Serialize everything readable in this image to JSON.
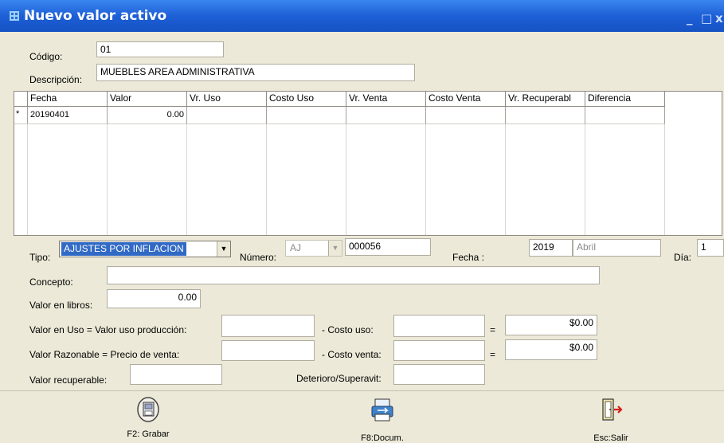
{
  "window": {
    "title": "Nuevo valor activo",
    "icon": "asset-icon",
    "controls": [
      "_",
      "□",
      "x"
    ]
  },
  "header": {
    "codigo_label": "Código:",
    "codigo_value": "01",
    "descripcion_label": "Descripción:",
    "descripcion_value": "MUEBLES AREA ADMINISTRATIVA"
  },
  "grid": {
    "columns": [
      "Fecha",
      "Valor",
      "Vr. Uso",
      "Costo Uso",
      "Vr. Venta",
      "Costo Venta",
      "Vr. Recuperabl",
      "Diferencia"
    ],
    "rows": [
      {
        "marker": "*",
        "cells": [
          "20190401",
          "0.00",
          "",
          "",
          "",
          "",
          "",
          ""
        ]
      }
    ]
  },
  "form": {
    "tipo_label": "Tipo:",
    "tipo_value": "AJUSTES POR INFLACION",
    "numero_label": "Número:",
    "numero_prefix": "AJ",
    "numero_value": "000056",
    "fecha_label": "Fecha :",
    "fecha_year": "2019",
    "fecha_month": "Abril",
    "dia_label": "Día:",
    "dia_value": "1",
    "concepto_label": "Concepto:",
    "concepto_value": "",
    "valor_libros_label": "Valor en libros:",
    "valor_libros_value": "0.00",
    "valor_uso_label": "Valor en Uso  =  Valor uso producción:",
    "valor_uso_value": "",
    "costo_uso_label": "- Costo uso:",
    "costo_uso_value": "",
    "eq1": "=",
    "valor_uso_result": "$0.00",
    "valor_razonable_label": "Valor Razonable  =  Precio de venta:",
    "precio_venta_value": "",
    "costo_venta_label": "- Costo venta:",
    "costo_venta_value": "",
    "eq2": "=",
    "valor_razonable_result": "$0.00",
    "valor_recuperable_label": "Valor recuperable:",
    "valor_recuperable_value": "",
    "deterioro_label": "Deterioro/Superavit:",
    "deterioro_value": ""
  },
  "toolbar": {
    "grabar": "F2: Grabar",
    "documentos": "F8:Docum.",
    "salir": "Esc:Salir"
  },
  "colors": {
    "titlebar": "#1d5fd6",
    "panel": "#ece9d8",
    "selection": "#316ac5"
  }
}
